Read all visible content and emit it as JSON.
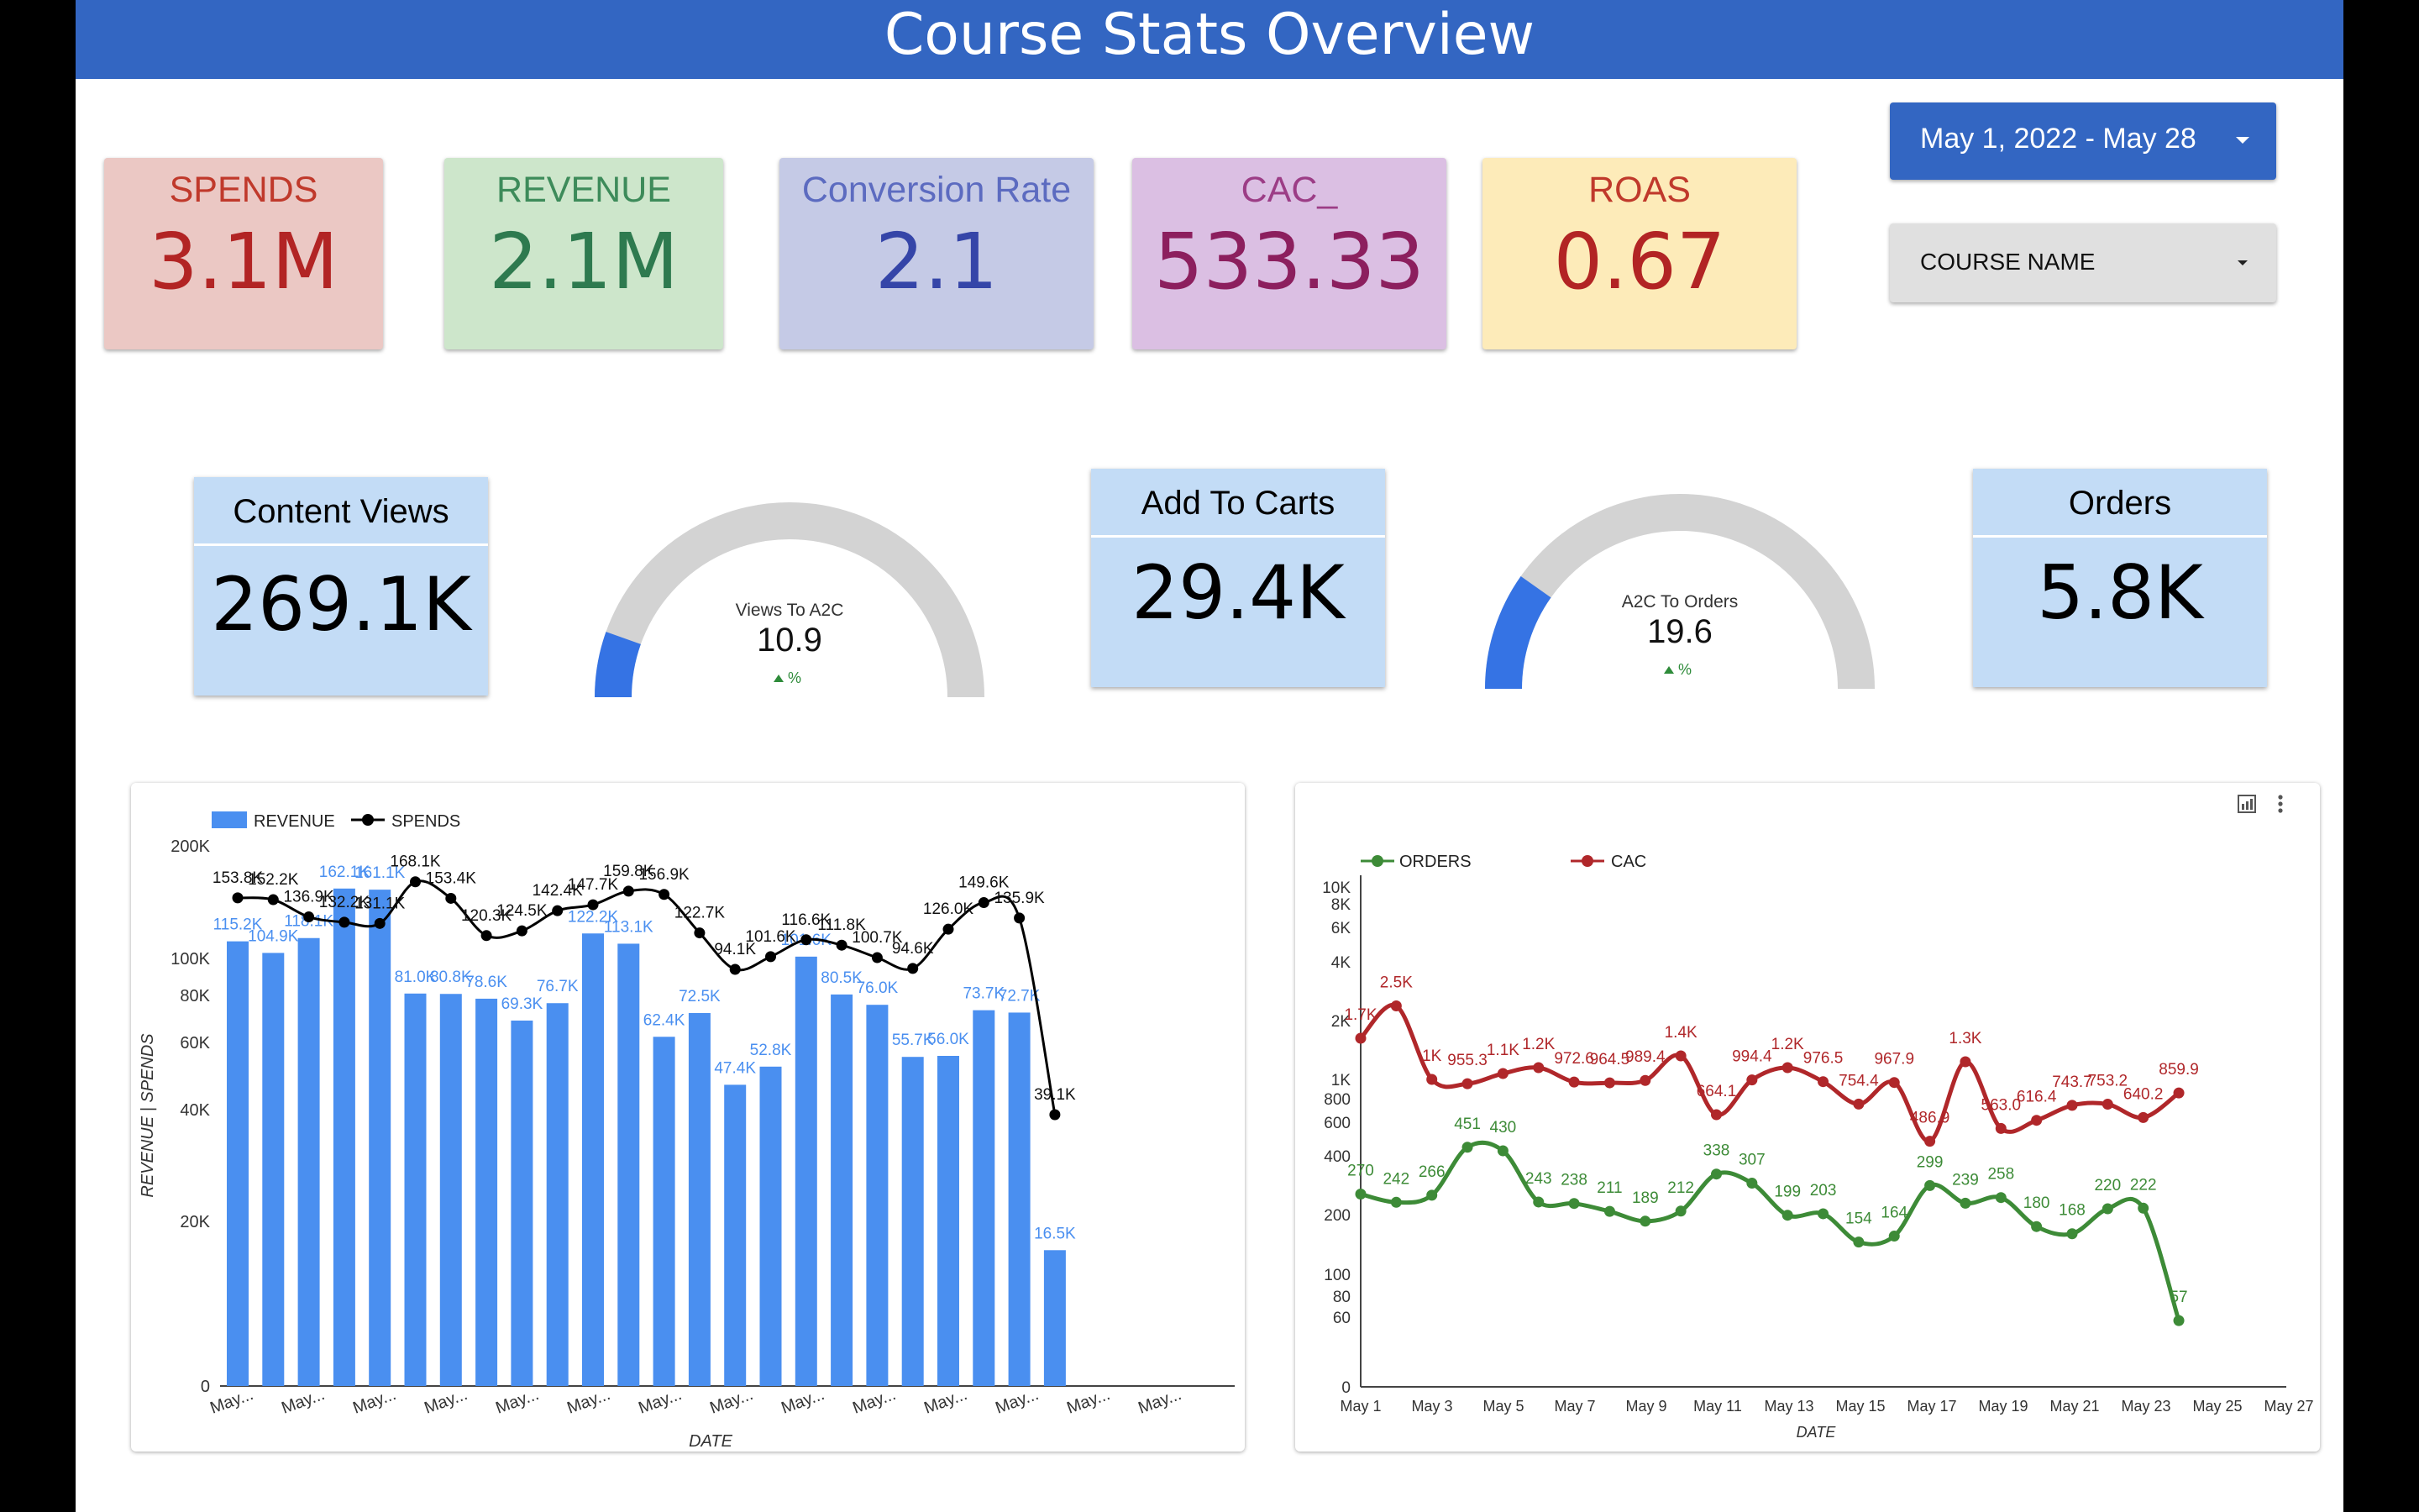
{
  "header": {
    "title": "Course Stats Overview"
  },
  "scorecards": [
    {
      "label": "SPENDS",
      "value": "3.1M"
    },
    {
      "label": "REVENUE",
      "value": "2.1M"
    },
    {
      "label": "Conversion Rate",
      "value": "2.1"
    },
    {
      "label": "CAC_",
      "value": "533.33"
    },
    {
      "label": "ROAS",
      "value": "0.67"
    }
  ],
  "controls": {
    "date_range": "May 1, 2022 - May 28",
    "course_filter": "COURSE NAME"
  },
  "funnel": {
    "content_views": {
      "title": "Content Views",
      "value": "269.1K"
    },
    "add_to_carts": {
      "title": "Add To Carts",
      "value": "29.4K"
    },
    "orders": {
      "title": "Orders",
      "value": "5.8K"
    }
  },
  "gauges": [
    {
      "label": "Views To A2C",
      "value": "10.9",
      "level": 10.9,
      "trend": "%"
    },
    {
      "label": "A2C To Orders",
      "value": "19.6",
      "level": 19.6,
      "trend": "%"
    }
  ],
  "colors": {
    "header": "#3366c2",
    "revenue_bar": "#4a8ff0",
    "spends_line": "#000000",
    "orders_line": "#3d8b37",
    "cac_line": "#b0272a",
    "gauge_fill": "#3573e4",
    "gauge_track": "#d3d3d3"
  },
  "chart_data": [
    {
      "type": "bar",
      "legend": [
        "REVENUE",
        "SPENDS"
      ],
      "legend_position": "top-left",
      "ylabel": "REVENUE | SPENDS",
      "xlabel": "DATE",
      "y_ticks": [
        "200K",
        "100K",
        "80K",
        "60K",
        "40K",
        "20K",
        "0"
      ],
      "x_ticks": [
        "May...",
        "May...",
        "May...",
        "May...",
        "May...",
        "May...",
        "May...",
        "May...",
        "May...",
        "May...",
        "May...",
        "May...",
        "May...",
        "May..."
      ],
      "series": [
        {
          "name": "REVENUE",
          "labels": [
            "115.2K",
            "104.9K",
            "118.1K",
            "162.1K",
            "161.1K",
            "81.0K",
            "80.8K",
            "78.6K",
            "69.3K",
            "76.7K",
            "122.2K",
            "113.1K",
            "62.4K",
            "72.5K",
            "47.4K",
            "52.8K",
            "101.6K",
            "80.5K",
            "76.0K",
            "55.7K",
            "56.0K",
            "73.7K",
            "72.7K",
            "16.5K"
          ]
        },
        {
          "name": "SPENDS",
          "labels": [
            "153.8K",
            "152.2K",
            "136.9K",
            "132.2K",
            "131.1K",
            "168.1K",
            "153.4K",
            "120.3K",
            "124.5K",
            "142.4K",
            "147.7K",
            "159.8K",
            "156.9K",
            "122.7K",
            "94.1K",
            "101.6K",
            "116.6K",
            "111.8K",
            "100.7K",
            "94.6K",
            "126.0K",
            "149.6K",
            "135.9K",
            "39.1K"
          ]
        }
      ]
    },
    {
      "type": "line",
      "legend": [
        "ORDERS",
        "CAC"
      ],
      "legend_position": "top-left",
      "xlabel": "DATE",
      "y_ticks": [
        "10K",
        "8K",
        "6K",
        "4K",
        "2K",
        "1K",
        "800",
        "600",
        "400",
        "200",
        "100",
        "80",
        "60",
        "0"
      ],
      "x_ticks": [
        "May 1",
        "May 3",
        "May 5",
        "May 7",
        "May 9",
        "May 11",
        "May 13",
        "May 15",
        "May 17",
        "May 19",
        "May 21",
        "May 23",
        "May 25",
        "May 27"
      ],
      "series": [
        {
          "name": "ORDERS",
          "values": [
            270,
            242,
            266,
            451,
            430,
            243,
            238,
            211,
            189,
            212,
            338,
            307,
            199,
            203,
            154,
            164,
            299,
            239,
            258,
            180,
            168,
            220,
            222,
            57
          ]
        },
        {
          "name": "CAC",
          "labels": [
            "1.7K",
            "2.5K",
            "1K",
            "955.3",
            "1.1K",
            "1.2K",
            "972.6",
            "964.5",
            "989.4",
            "1.4K",
            "664.1",
            "994.4",
            "1.2K",
            "976.5",
            "754.4",
            "967.9",
            "486.9",
            "1.3K",
            "563.0",
            "616.4",
            "743.7",
            "753.2",
            "640.2",
            "859.9"
          ]
        }
      ]
    }
  ]
}
